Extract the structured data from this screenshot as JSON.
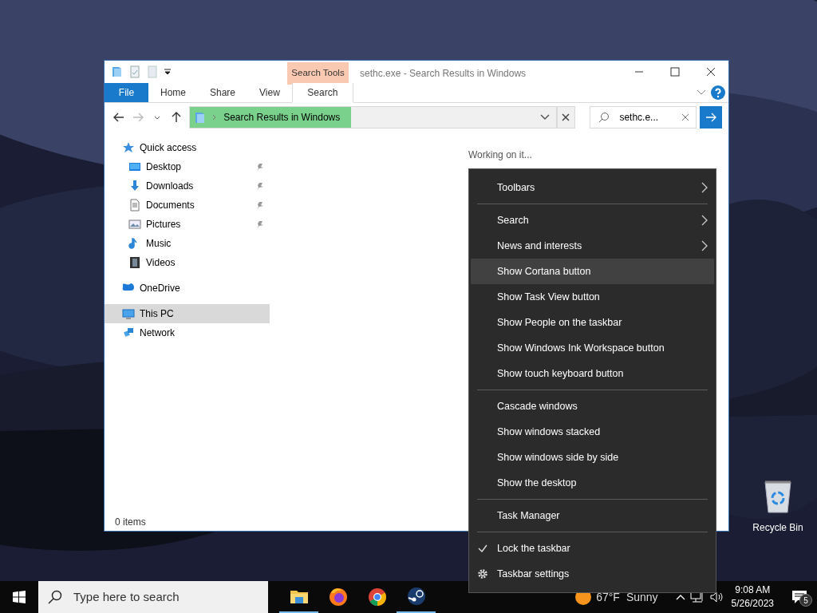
{
  "explorer": {
    "title": "sethc.exe - Search Results in Windows",
    "contextual_group": "Search Tools",
    "ribbon_tabs": [
      {
        "label": "File",
        "selected": false,
        "kind": "file"
      },
      {
        "label": "Home",
        "selected": false,
        "kind": "tab"
      },
      {
        "label": "Share",
        "selected": false,
        "kind": "tab"
      },
      {
        "label": "View",
        "selected": false,
        "kind": "tab"
      },
      {
        "label": "Search",
        "selected": true,
        "kind": "contextual"
      }
    ],
    "address": {
      "text": "Search Results in Windows",
      "level": 0.44
    },
    "search": {
      "value": "sethc.e..."
    },
    "navigation": [
      {
        "label": "Quick access",
        "selected": false,
        "children": [
          {
            "label": "Desktop",
            "pinned": true,
            "selected": false
          },
          {
            "label": "Downloads",
            "pinned": true,
            "selected": false
          },
          {
            "label": "Documents",
            "pinned": true,
            "selected": false
          },
          {
            "label": "Pictures",
            "pinned": true,
            "selected": false
          },
          {
            "label": "Music",
            "pinned": false,
            "selected": false
          },
          {
            "label": "Videos",
            "pinned": false,
            "selected": false
          }
        ]
      },
      {
        "label": "OneDrive",
        "selected": false
      },
      {
        "label": "This PC",
        "selected": true
      },
      {
        "label": "Network",
        "selected": false
      }
    ],
    "content_message": "Working on it...",
    "status_bar": "0 items"
  },
  "context_menu": {
    "groups": [
      [
        {
          "label": "Toolbars",
          "kind": "submenu",
          "selected": false
        }
      ],
      [
        {
          "label": "Search",
          "kind": "submenu",
          "selected": false
        },
        {
          "label": "News and interests",
          "kind": "submenu",
          "selected": false
        },
        {
          "label": "Show Cortana button",
          "kind": "command",
          "selected": true
        },
        {
          "label": "Show Task View button",
          "kind": "command",
          "selected": false
        },
        {
          "label": "Show People on the taskbar",
          "kind": "command",
          "selected": false
        },
        {
          "label": "Show Windows Ink Workspace button",
          "kind": "command",
          "selected": false
        },
        {
          "label": "Show touch keyboard button",
          "kind": "command",
          "selected": false
        }
      ],
      [
        {
          "label": "Cascade windows",
          "kind": "command",
          "selected": false
        },
        {
          "label": "Show windows stacked",
          "kind": "command",
          "selected": false
        },
        {
          "label": "Show windows side by side",
          "kind": "command",
          "selected": false
        },
        {
          "label": "Show the desktop",
          "kind": "command",
          "selected": false
        }
      ],
      [
        {
          "label": "Task Manager",
          "kind": "command",
          "selected": false
        }
      ],
      [
        {
          "label": "Lock the taskbar",
          "kind": "toggle",
          "checked": true,
          "selected": false
        },
        {
          "label": "Taskbar settings",
          "kind": "settings",
          "selected": false
        }
      ]
    ]
  },
  "desktop_icons": [
    {
      "label": "Recycle Bin"
    }
  ],
  "taskbar": {
    "search_placeholder": "Type here to search",
    "apps": [
      {
        "kind": "folder",
        "running": true
      },
      {
        "kind": "firefox",
        "running": false
      },
      {
        "kind": "chrome",
        "running": false
      },
      {
        "kind": "steam",
        "running": true
      }
    ],
    "weather": {
      "temperature": "67°F",
      "condition": "Sunny"
    },
    "time": "9:08 AM",
    "date": "5/26/2023",
    "notifications": "5"
  }
}
